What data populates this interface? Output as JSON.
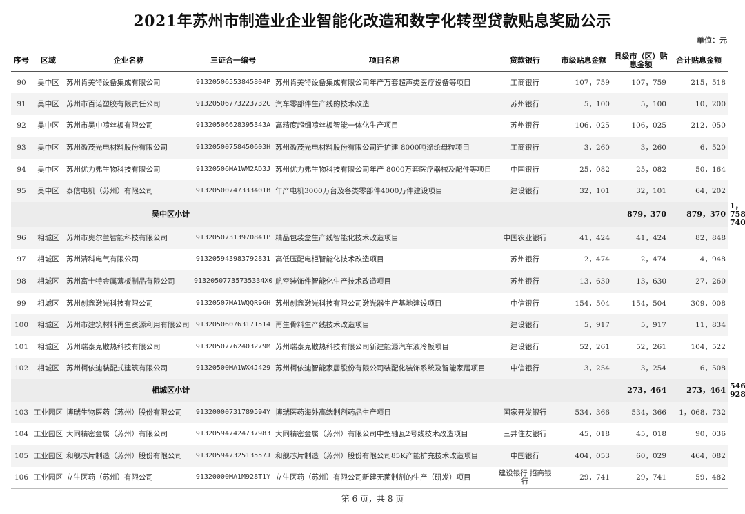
{
  "title": "2021年苏州市制造业企业智能化改造和数字化转型贷款贴息奖励公示",
  "unit": "单位：元",
  "columns": {
    "no": "序号",
    "district": "区域",
    "company": "企业名称",
    "code": "三证合一编号",
    "project": "项目名称",
    "bank": "贷款银行",
    "city": "市级贴息金额",
    "county": "县级市（区）贴息金额",
    "total": "合计贴息金额"
  },
  "rows": [
    {
      "type": "row",
      "no": "90",
      "district": "吴中区",
      "company": "苏州肯美特设备集成有限公司",
      "code": "91320506553845804P",
      "project": "苏州肯美特设备集成有限公司年产万套超声类医疗设备等项目",
      "bank": "工商银行",
      "city": "107，759",
      "county": "107，759",
      "total": "215，518"
    },
    {
      "type": "row",
      "no": "91",
      "district": "吴中区",
      "company": "苏州市百诺塑胶有限责任公司",
      "code": "91320506773223732C",
      "project": "汽车零部件生产线的技术改造",
      "bank": "苏州银行",
      "city": "5，100",
      "county": "5，100",
      "total": "10，200"
    },
    {
      "type": "row",
      "no": "92",
      "district": "吴中区",
      "company": "苏州市吴中喷丝板有限公司",
      "code": "91320506628395343A",
      "project": "高精度超细喷丝板智能一体化生产项目",
      "bank": "苏州银行",
      "city": "106，025",
      "county": "106，025",
      "total": "212，050"
    },
    {
      "type": "row",
      "no": "93",
      "district": "吴中区",
      "company": "苏州盈茂光电材料股份有限公司",
      "code": "91320500758450603H",
      "project": "苏州盈茂光电材料股份有限公司迁扩建 8000吨涤纶母粒项目",
      "bank": "工商银行",
      "city": "3，260",
      "county": "3，260",
      "total": "6，520"
    },
    {
      "type": "row",
      "no": "94",
      "district": "吴中区",
      "company": "苏州优力弗生物科技有限公司",
      "code": "91320506MA1WM2AD3J",
      "project": "苏州优力弗生物科技有限公司年产 8000万套医疗器械及配件等项目",
      "bank": "中国银行",
      "city": "25，082",
      "county": "25，082",
      "total": "50，164"
    },
    {
      "type": "row",
      "no": "95",
      "district": "吴中区",
      "company": "泰信电机（苏州）有限公司",
      "code": "91320500747333401B",
      "project": "年产电机3000万台及各类零部件4000万件建设项目",
      "bank": "建设银行",
      "city": "32，101",
      "county": "32，101",
      "total": "64，202"
    },
    {
      "type": "subtotal",
      "label": "吴中区小计",
      "city": "879，370",
      "county": "879，370",
      "total": "1，758，740"
    },
    {
      "type": "row",
      "no": "96",
      "district": "相城区",
      "company": "苏州市奥尔兰智能科技有限公司",
      "code": "91320507313970841P",
      "project": "精品包装盒生产线智能化技术改造项目",
      "bank": "中国农业银行",
      "city": "41，424",
      "county": "41，424",
      "total": "82，848"
    },
    {
      "type": "row",
      "no": "97",
      "district": "相城区",
      "company": "苏州清科电气有限公司",
      "code": "913205943983792831",
      "project": "高低压配电柜智能化技术改造项目",
      "bank": "苏州银行",
      "city": "2，474",
      "county": "2，474",
      "total": "4，948"
    },
    {
      "type": "row",
      "no": "98",
      "district": "相城区",
      "company": "苏州富士特金属薄板制品有限公司",
      "code": "91320507735735334X0",
      "project": "航空装饰件智能化生产技术改造项目",
      "bank": "苏州银行",
      "city": "13，630",
      "county": "13，630",
      "total": "27，260"
    },
    {
      "type": "row",
      "no": "99",
      "district": "相城区",
      "company": "苏州创鑫激光科技有限公司",
      "code": "91320507MA1WQQR96H",
      "project": "苏州创鑫激光科技有限公司激光器生产基地建设项目",
      "bank": "中信银行",
      "city": "154，504",
      "county": "154，504",
      "total": "309，008"
    },
    {
      "type": "row",
      "no": "100",
      "district": "相城区",
      "company": "苏州市建筑材料再生资源利用有限公司",
      "code": "913205060763171514",
      "project": "再生骨料生产线技术改造项目",
      "bank": "建设银行",
      "city": "5，917",
      "county": "5，917",
      "total": "11，834"
    },
    {
      "type": "row",
      "no": "101",
      "district": "相城区",
      "company": "苏州瑞泰克散热科技有限公司",
      "code": "91320507762403279M",
      "project": "苏州瑞泰克散热科技有限公司新建能源汽车液冷板项目",
      "bank": "建设银行",
      "city": "52，261",
      "county": "52，261",
      "total": "104，522"
    },
    {
      "type": "row",
      "no": "102",
      "district": "相城区",
      "company": "苏州柯依迪装配式建筑有限公司",
      "code": "91320500MA1WX4J429",
      "project": "苏州柯依迪智能家居股份有限公司装配化装饰系统及智能家居项目",
      "bank": "中信银行",
      "city": "3，254",
      "county": "3，254",
      "total": "6，508"
    },
    {
      "type": "subtotal",
      "label": "相城区小计",
      "city": "273，464",
      "county": "273，464",
      "total": "546，928"
    },
    {
      "type": "row",
      "no": "103",
      "district": "工业园区",
      "company": "博瑞生物医药（苏州）股份有限公司",
      "code": "91320000731789594Y",
      "project": "博瑞医药海外高端制剂药品生产项目",
      "bank": "国家开发银行",
      "city": "534，366",
      "county": "534，366",
      "total": "1，068，732"
    },
    {
      "type": "row",
      "no": "104",
      "district": "工业园区",
      "company": "大同精密金属（苏州）有限公司",
      "code": "913205947424737983",
      "project": "大同精密金属（苏州）有限公司中型轴瓦2号线技术改造项目",
      "bank": "三井住友银行",
      "city": "45，018",
      "county": "45，018",
      "total": "90，036"
    },
    {
      "type": "row",
      "no": "105",
      "district": "工业园区",
      "company": "和舰芯片制造（苏州）股份有限公司",
      "code": "91320594732513557J",
      "project": "和舰芯片制造（苏州）股份有限公司85K产能扩充技术改造项目",
      "bank": "中国银行",
      "city": "404，053",
      "county": "60，029",
      "total": "464，082"
    },
    {
      "type": "row",
      "no": "106",
      "district": "工业园区",
      "company": "立生医药（苏州）有限公司",
      "code": "91320000MA1M928T1Y",
      "project": "立生医药（苏州）有限公司新建无菌制剂的生产（研发）项目",
      "bank": "建设银行 招商银行",
      "city": "29，741",
      "county": "29，741",
      "total": "59，482"
    }
  ],
  "footer": "第 6 页，共 8 页"
}
